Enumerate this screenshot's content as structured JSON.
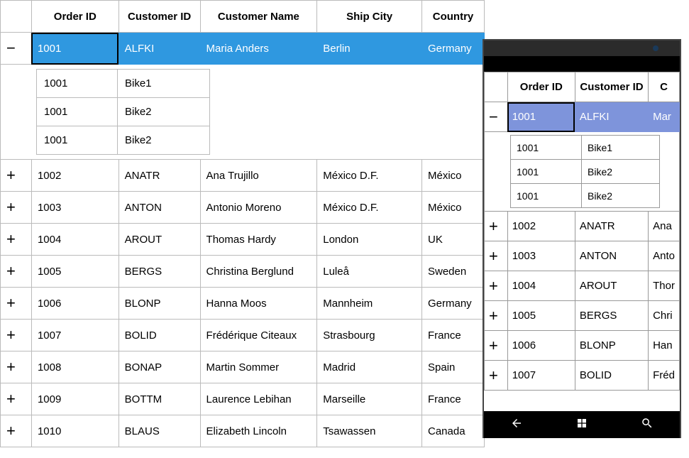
{
  "headers": {
    "exp": "",
    "order_id": "Order ID",
    "customer_id": "Customer ID",
    "customer_name": "Customer Name",
    "ship_city": "Ship City",
    "country": "Country"
  },
  "icons": {
    "expand": "+",
    "collapse": "−"
  },
  "rows": [
    {
      "expanded": true,
      "selected": true,
      "order_id": "1001",
      "customer_id": "ALFKI",
      "customer_name": "Maria Anders",
      "ship_city": "Berlin",
      "country": "Germany",
      "details": [
        {
          "c0": "1001",
          "c1": "Bike1"
        },
        {
          "c0": "1001",
          "c1": "Bike2"
        },
        {
          "c0": "1001",
          "c1": "Bike2"
        }
      ]
    },
    {
      "expanded": false,
      "order_id": "1002",
      "customer_id": "ANATR",
      "customer_name": "Ana Trujillo",
      "ship_city": "México D.F.",
      "country": "México"
    },
    {
      "expanded": false,
      "order_id": "1003",
      "customer_id": "ANTON",
      "customer_name": "Antonio Moreno",
      "ship_city": "México D.F.",
      "country": "México"
    },
    {
      "expanded": false,
      "order_id": "1004",
      "customer_id": "AROUT",
      "customer_name": "Thomas Hardy",
      "ship_city": "London",
      "country": "UK"
    },
    {
      "expanded": false,
      "order_id": "1005",
      "customer_id": "BERGS",
      "customer_name": "Christina Berglund",
      "ship_city": "Luleå",
      "country": "Sweden"
    },
    {
      "expanded": false,
      "order_id": "1006",
      "customer_id": "BLONP",
      "customer_name": "Hanna Moos",
      "ship_city": "Mannheim",
      "country": "Germany"
    },
    {
      "expanded": false,
      "order_id": "1007",
      "customer_id": "BOLID",
      "customer_name": "Frédérique Citeaux",
      "ship_city": "Strasbourg",
      "country": "France"
    },
    {
      "expanded": false,
      "order_id": "1008",
      "customer_id": "BONAP",
      "customer_name": "Martin Sommer",
      "ship_city": "Madrid",
      "country": "Spain"
    },
    {
      "expanded": false,
      "order_id": "1009",
      "customer_id": "BOTTM",
      "customer_name": "Laurence Lebihan",
      "ship_city": "Marseille",
      "country": "France"
    },
    {
      "expanded": false,
      "order_id": "1010",
      "customer_id": "BLAUS",
      "customer_name": "Elizabeth Lincoln",
      "ship_city": "Tsawassen",
      "country": "Canada"
    }
  ],
  "phone": {
    "rows": [
      {
        "expanded": true,
        "selected": true,
        "order_id": "1001",
        "customer_id": "ALFKI",
        "customer_name": "Mar",
        "details": [
          {
            "c0": "1001",
            "c1": "Bike1"
          },
          {
            "c0": "1001",
            "c1": "Bike2"
          },
          {
            "c0": "1001",
            "c1": "Bike2"
          }
        ]
      },
      {
        "expanded": false,
        "order_id": "1002",
        "customer_id": "ANATR",
        "customer_name": "Ana"
      },
      {
        "expanded": false,
        "order_id": "1003",
        "customer_id": "ANTON",
        "customer_name": "Anto"
      },
      {
        "expanded": false,
        "order_id": "1004",
        "customer_id": "AROUT",
        "customer_name": "Thor"
      },
      {
        "expanded": false,
        "order_id": "1005",
        "customer_id": "BERGS",
        "customer_name": "Chri"
      },
      {
        "expanded": false,
        "order_id": "1006",
        "customer_id": "BLONP",
        "customer_name": "Han"
      },
      {
        "expanded": false,
        "order_id": "1007",
        "customer_id": "BOLID",
        "customer_name": "Fréd"
      }
    ]
  }
}
